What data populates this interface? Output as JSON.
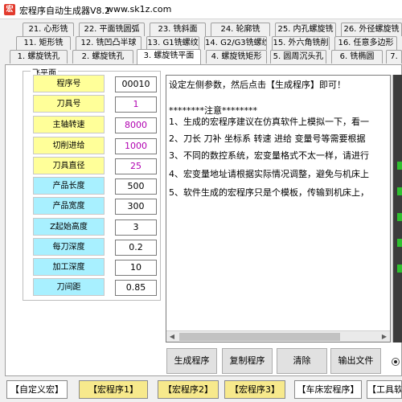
{
  "window": {
    "title": "宏程序自动生成器V8.2",
    "url": "www.sk1z.com"
  },
  "tabs_row1": [
    "21. 心形铣",
    "22. 平面铣圆弧",
    "23. 铣斜面",
    "24. 轮廓铣",
    "25. 内孔螺旋铣",
    "26. 外径螺旋铣"
  ],
  "tabs_row2": [
    "11. 矩形铣",
    "12. 铣凹凸半球",
    "13. G1铣螺纹",
    "14. G2/G3铣螺纹",
    "15. 外六角铣削",
    "16. 任意多边形"
  ],
  "tabs_row3": [
    "1. 螺旋铣孔",
    "2. 螺旋铣孔",
    "3. 螺旋铣平面",
    "4. 螺旋铣矩形",
    "5. 圆周沉头孔",
    "6. 铣椭圆",
    "7."
  ],
  "group": {
    "label": "飞平面"
  },
  "params": [
    {
      "label": "程序号",
      "value": "00010"
    },
    {
      "label": "刀具号",
      "value": "1"
    },
    {
      "label": "主轴转速",
      "value": "8000"
    },
    {
      "label": "切削进给",
      "value": "1000"
    },
    {
      "label": "刀具直径",
      "value": "25"
    },
    {
      "label": "产品长度",
      "value": "500"
    },
    {
      "label": "产品宽度",
      "value": "300"
    },
    {
      "label": "Z起始高度",
      "value": "3"
    },
    {
      "label": "每刀深度",
      "value": "0.2"
    },
    {
      "label": "加工深度",
      "value": "10"
    },
    {
      "label": "刀间距",
      "value": "0.85"
    }
  ],
  "output_lines": [
    "设定左侧参数，然后点击【生成程序】即可！",
    "",
    "********注意********",
    "1、生成的宏程序建议在仿真软件上模拟一下，看一",
    "2、刀长 刀补 坐标系 转速 进给 变量号等需要根据",
    "3、不同的数控系统，宏变量格式不太一样，请进行",
    "4、宏变量地址请根据实际情况调整，避免与机床上",
    "5、软件生成的宏程序只是个模板，传输到机床上，"
  ],
  "actions": {
    "generate": "生成程序",
    "copy": "复制程序",
    "clear": "清除",
    "export": "输出文件"
  },
  "bottom_buttons": [
    "【自定义宏】",
    "【宏程序1】",
    "【宏程序2】",
    "【宏程序3】",
    "【车床宏程序】",
    "【工具软"
  ],
  "colors": {
    "yellow_label": "#ffff99",
    "cyan_label": "#a8f0ff",
    "value_purple": "#b000b0"
  }
}
